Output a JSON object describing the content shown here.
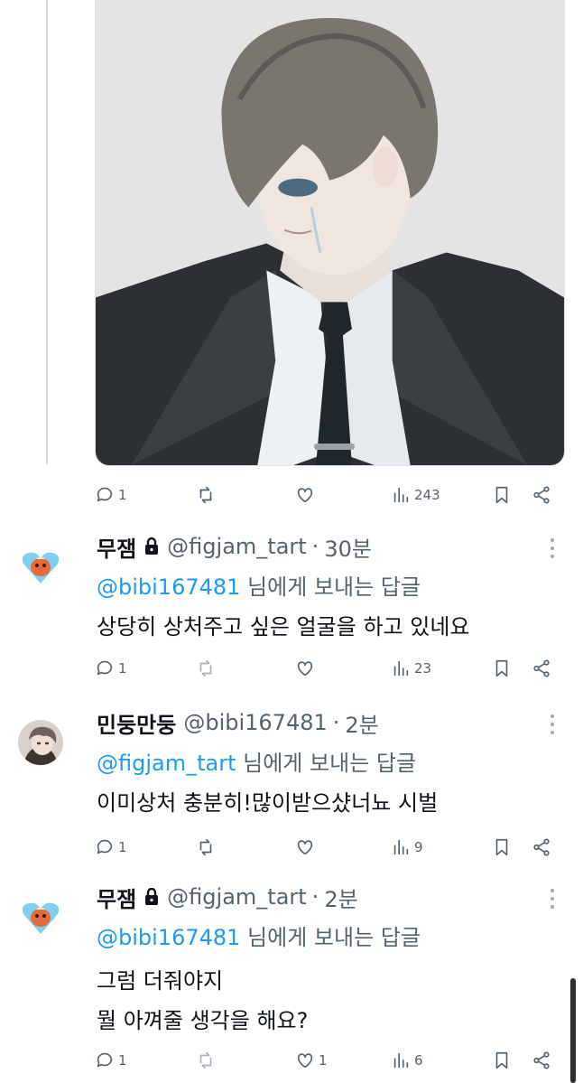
{
  "original_tweet": {
    "stats": {
      "replies": "1",
      "retweets": "",
      "likes": "",
      "views": "243"
    }
  },
  "replies": [
    {
      "name": "무잼",
      "handle": "@figjam_tart",
      "time": "30분",
      "protected": true,
      "reply_to_mention": "@bibi167481",
      "reply_to_suffix": " 님에게 보내는 답글",
      "text_lines": [
        "상당히 상처주고 싶은 얼굴을 하고 있네요"
      ],
      "stats": {
        "replies": "1",
        "retweets": "",
        "likes": "",
        "views": "23"
      }
    },
    {
      "name": "민둥만둥",
      "handle": "@bibi167481",
      "time": "2분",
      "protected": false,
      "reply_to_mention": "@figjam_tart",
      "reply_to_suffix": " 님에게 보내는 답글",
      "text_lines": [
        "이미상처 충분히!많이받으샸너뇨 시벌"
      ],
      "stats": {
        "replies": "1",
        "retweets": "",
        "likes": "",
        "views": "9"
      }
    },
    {
      "name": "무잼",
      "handle": "@figjam_tart",
      "time": "2분",
      "protected": true,
      "reply_to_mention": "@bibi167481",
      "reply_to_suffix": " 님에게 보내는 답글",
      "text_lines": [
        "그럼 더줘야지",
        "뭘 아껴줄 생각을 해요?"
      ],
      "stats": {
        "replies": "1",
        "retweets": "",
        "likes": "1",
        "views": "6"
      }
    }
  ],
  "separator": "·",
  "icons": {
    "reply": "reply-icon",
    "retweet": "retweet-icon",
    "like": "heart-icon",
    "views": "views-chart-icon",
    "bookmark": "bookmark-icon",
    "share": "share-icon",
    "lock": "lock-icon",
    "more": "more-icon"
  },
  "colors": {
    "link": "#1d9bf0",
    "muted": "#536471",
    "text": "#0f1419"
  }
}
